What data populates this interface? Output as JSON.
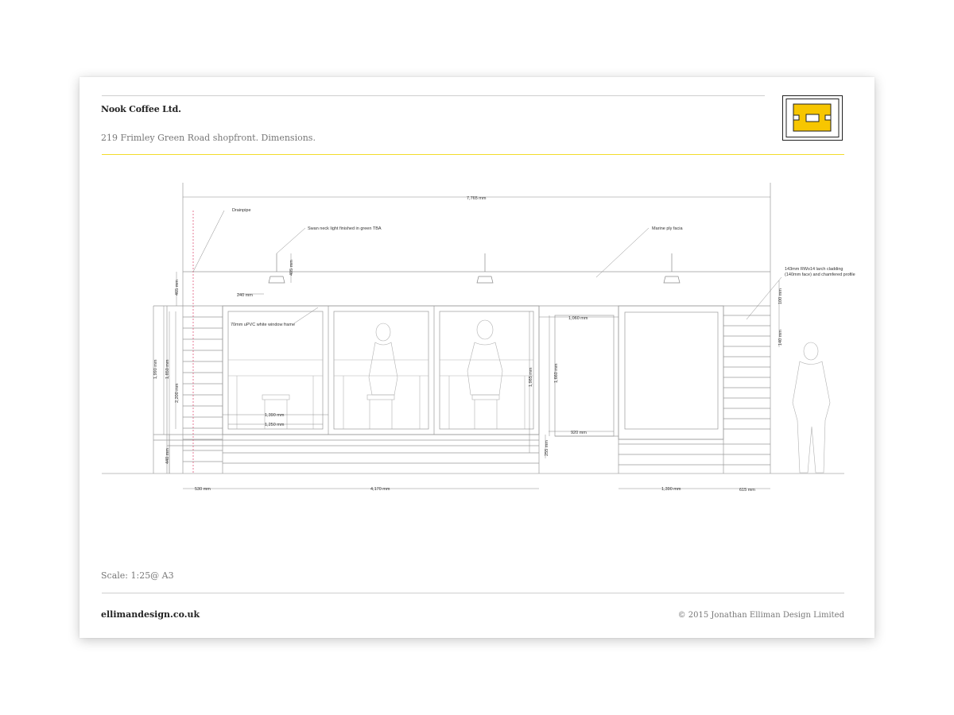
{
  "header": {
    "client": "Nook Coffee Ltd.",
    "subtitle": "219 Frimley Green Road shopfront. Dimensions."
  },
  "footer": {
    "scale": "Scale: 1:25@ A3",
    "website": "ellimandesign.co.uk",
    "copyright": "© 2015 Jonathan Elliman Design Limited"
  },
  "colors": {
    "accent_rule": "#f2dc2b",
    "logo_yellow": "#f7c600",
    "drainpipe": "#e05a7a",
    "linework": "#9a9a9a"
  },
  "drawing": {
    "annotations": {
      "drainpipe": "Drainpipe",
      "swan_neck": "Swan neck light finished in green TBA",
      "marine_ply": "Marine ply facia",
      "cladding_1": "143mm RWo14 larch cladding",
      "cladding_2": "(140mm face) and chamfered profile",
      "window_frame": "70mm uPVC white window frame"
    },
    "dimensions": {
      "overall": "7,765 mm",
      "fascia_h": "465 mm",
      "light_w": "240 mm",
      "light_h": "405 mm",
      "w1390a": "1,390 mm",
      "w1250": "1,250 mm",
      "h1990": "1,990 mm",
      "h1850": "1,850 mm",
      "h2200": "2,200 mm",
      "h440": "440 mm",
      "h1985": "1,985 mm",
      "h255": "255 mm",
      "h1660": "1,660 mm",
      "w1060": "1,060 mm",
      "w920": "920 mm",
      "h100": "100 mm",
      "h140": "140 mm",
      "w530": "530 mm",
      "w4170": "4,170 mm",
      "w1390b": "1,390 mm",
      "w615": "615 mm"
    }
  }
}
